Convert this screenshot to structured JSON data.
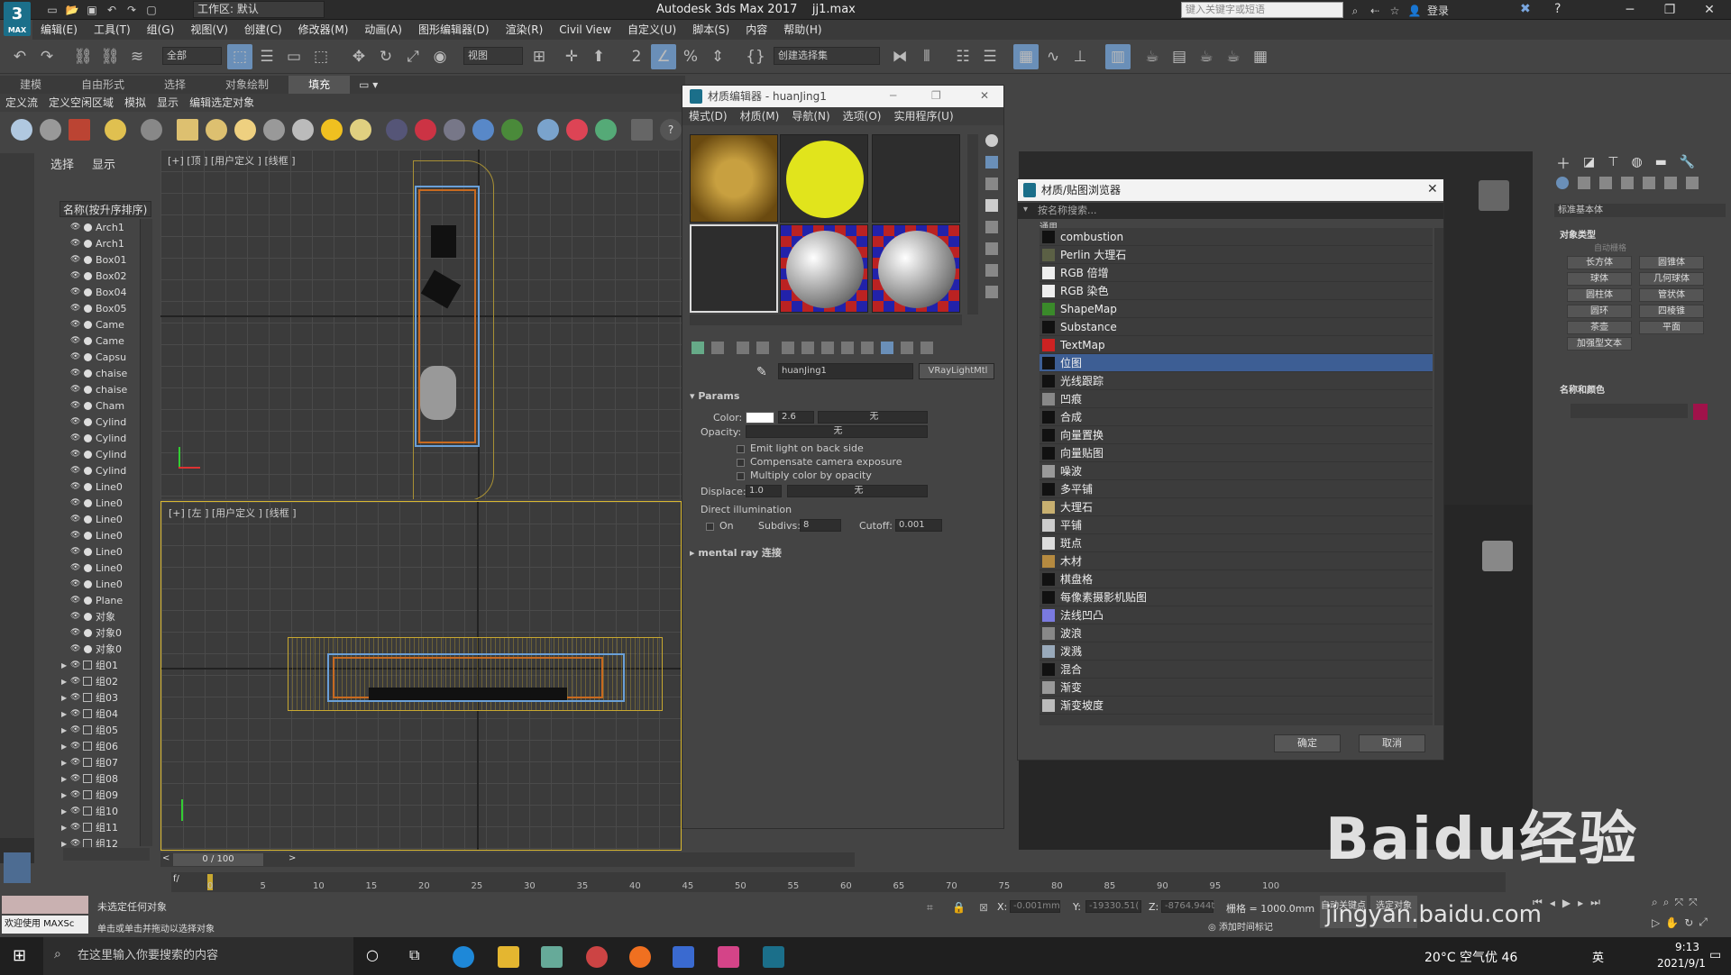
{
  "app": {
    "logo_text": "3",
    "logo_sub": "MAX",
    "workspace": "工作区: 默认",
    "title": "Autodesk 3ds Max 2017",
    "filename": "jj1.max",
    "search_placeholder": "键入关键字或短语",
    "login": "登录"
  },
  "menu": [
    "编辑(E)",
    "工具(T)",
    "组(G)",
    "视图(V)",
    "创建(C)",
    "修改器(M)",
    "动画(A)",
    "图形编辑器(D)",
    "渲染(R)",
    "Civil View",
    "自定义(U)",
    "脚本(S)",
    "内容",
    "帮助(H)"
  ],
  "toolbar": {
    "filter": "全部",
    "view": "视图",
    "selection_set": "创建选择集"
  },
  "ribbon": {
    "tabs": [
      "建模",
      "自由形式",
      "选择",
      "对象绘制",
      "填充"
    ],
    "selected_tab": "填充",
    "sub": [
      "定义流",
      "定义空闲区域",
      "模拟",
      "显示",
      "编辑选定对象"
    ]
  },
  "scene": {
    "tabs": [
      "选择",
      "显示"
    ],
    "header": "名称(按升序排序)",
    "items": [
      "Arch1",
      "Arch1",
      "Box01",
      "Box02",
      "Box04",
      "Box05",
      "Came",
      "Came",
      "Capsu",
      "chaise",
      "chaise",
      "Cham",
      "Cylind",
      "Cylind",
      "Cylind",
      "Cylind",
      "Line0",
      "Line0",
      "Line0",
      "Line0",
      "Line0",
      "Line0",
      "Line0",
      "Plane",
      "对象",
      "对象0",
      "对象0"
    ],
    "groups": [
      "组01",
      "组02",
      "组03",
      "组04",
      "组05",
      "组06",
      "组07",
      "组08",
      "组09",
      "组10",
      "组11",
      "组12"
    ]
  },
  "viewports": {
    "top_label": "[+] [顶 ] [用户定义 ] [线框 ]",
    "left_label": "[+] [左 ] [用户定义 ] [线框 ]"
  },
  "material_editor": {
    "title": "材质编辑器 - huanJing1",
    "menu": [
      "模式(D)",
      "材质(M)",
      "导航(N)",
      "选项(O)",
      "实用程序(U)"
    ],
    "material_name": "huanJing1",
    "material_type": "VRayLightMtl",
    "params_title": "Params",
    "color_label": "Color:",
    "color_value": "2.6",
    "none": "无",
    "opacity_label": "Opacity:",
    "emit_back": "Emit light on back side",
    "compensate": "Compensate camera exposure",
    "multiply": "Multiply color by opacity",
    "displace_label": "Displace:",
    "displace_value": "1.0",
    "direct_illum": "Direct illumination",
    "on_label": "On",
    "subdivs_label": "Subdivs:",
    "subdivs_value": "8",
    "cutoff_label": "Cutoff:",
    "cutoff_value": "0.001",
    "mental_ray": "mental ray 连接"
  },
  "browser": {
    "title": "材质/贴图浏览器",
    "search_placeholder": "按名称搜索...",
    "category": "通用",
    "items": [
      "combustion",
      "Perlin 大理石",
      "RGB 倍增",
      "RGB 染色",
      "ShapeMap",
      "Substance",
      "TextMap",
      "位图",
      "光线跟踪",
      "凹痕",
      "合成",
      "向量置换",
      "向量贴图",
      "噪波",
      "多平铺",
      "大理石",
      "平铺",
      "斑点",
      "木材",
      "棋盘格",
      "每像素摄影机贴图",
      "法线凹凸",
      "波浪",
      "泼溅",
      "混合",
      "渐变",
      "渐变坡度"
    ],
    "selected": "位图",
    "ok": "确定",
    "cancel": "取消"
  },
  "command_panel": {
    "category": "标准基本体",
    "object_type": "对象类型",
    "autogrid": "自动栅格",
    "buttons": [
      "长方体",
      "圆锥体",
      "球体",
      "几何球体",
      "圆柱体",
      "管状体",
      "圆环",
      "四棱锥",
      "茶壶",
      "平面",
      "加强型文本"
    ],
    "name_color": "名称和颜色"
  },
  "timeline": {
    "frame": "0 / 100",
    "ticks": [
      "0",
      "5",
      "10",
      "15",
      "20",
      "25",
      "30",
      "35",
      "40",
      "45",
      "50",
      "55",
      "60",
      "65",
      "70",
      "75",
      "80",
      "85",
      "90",
      "95",
      "100"
    ]
  },
  "status": {
    "welcome": "欢迎使用 MAXSc",
    "line1": "未选定任何对象",
    "line2": "单击或单击并拖动以选择对象",
    "x_label": "X:",
    "x_value": "-0.001mm",
    "y_label": "Y:",
    "y_value": "-19330.51(",
    "z_label": "Z:",
    "z_value": "-8764.944t",
    "grid": "栅格 = 1000.0mm",
    "add_tag": "添加时间标记",
    "auto_key": "自动关键点",
    "set_key": "选定对象"
  },
  "taskbar": {
    "search": "在这里输入你要搜索的内容",
    "weather": "20°C 空气优 46",
    "ime": "英",
    "time": "9:13",
    "date": "2021/9/1"
  },
  "watermark": {
    "brand": "Baidu经验",
    "url": "jingyan.baidu.com"
  },
  "colors": {
    "accent": "#3d5e94",
    "selected_slot_yellow": "#e1e41c",
    "ribbon_active": "#6a8fb8"
  }
}
